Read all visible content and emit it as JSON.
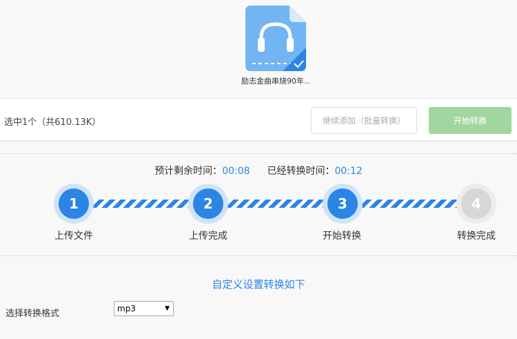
{
  "file": {
    "name": "励志金曲串烧90年…",
    "icon": "headphones-audio-file-icon",
    "checked": true
  },
  "action_bar": {
    "selection_text": "选中1个（共610.13K）",
    "add_more_label": "继续添加（批量转换）",
    "start_label": "开始转换"
  },
  "progress": {
    "remaining_label": "预计剩余时间：",
    "remaining_value": "00:08",
    "elapsed_label": "已经转换时间：",
    "elapsed_value": "00:12",
    "steps": [
      {
        "number": "1",
        "label": "上传文件",
        "state": "done"
      },
      {
        "number": "2",
        "label": "上传完成",
        "state": "done"
      },
      {
        "number": "3",
        "label": "开始转换",
        "state": "active"
      },
      {
        "number": "4",
        "label": "转换完成",
        "state": "pending"
      }
    ]
  },
  "settings": {
    "title": "自定义设置转换如下",
    "format_label": "选择转换格式",
    "format_value": "mp3"
  },
  "colors": {
    "accent": "#2b85e4",
    "start_button": "#a2d6a0",
    "pending_step": "#d7d7d7"
  }
}
